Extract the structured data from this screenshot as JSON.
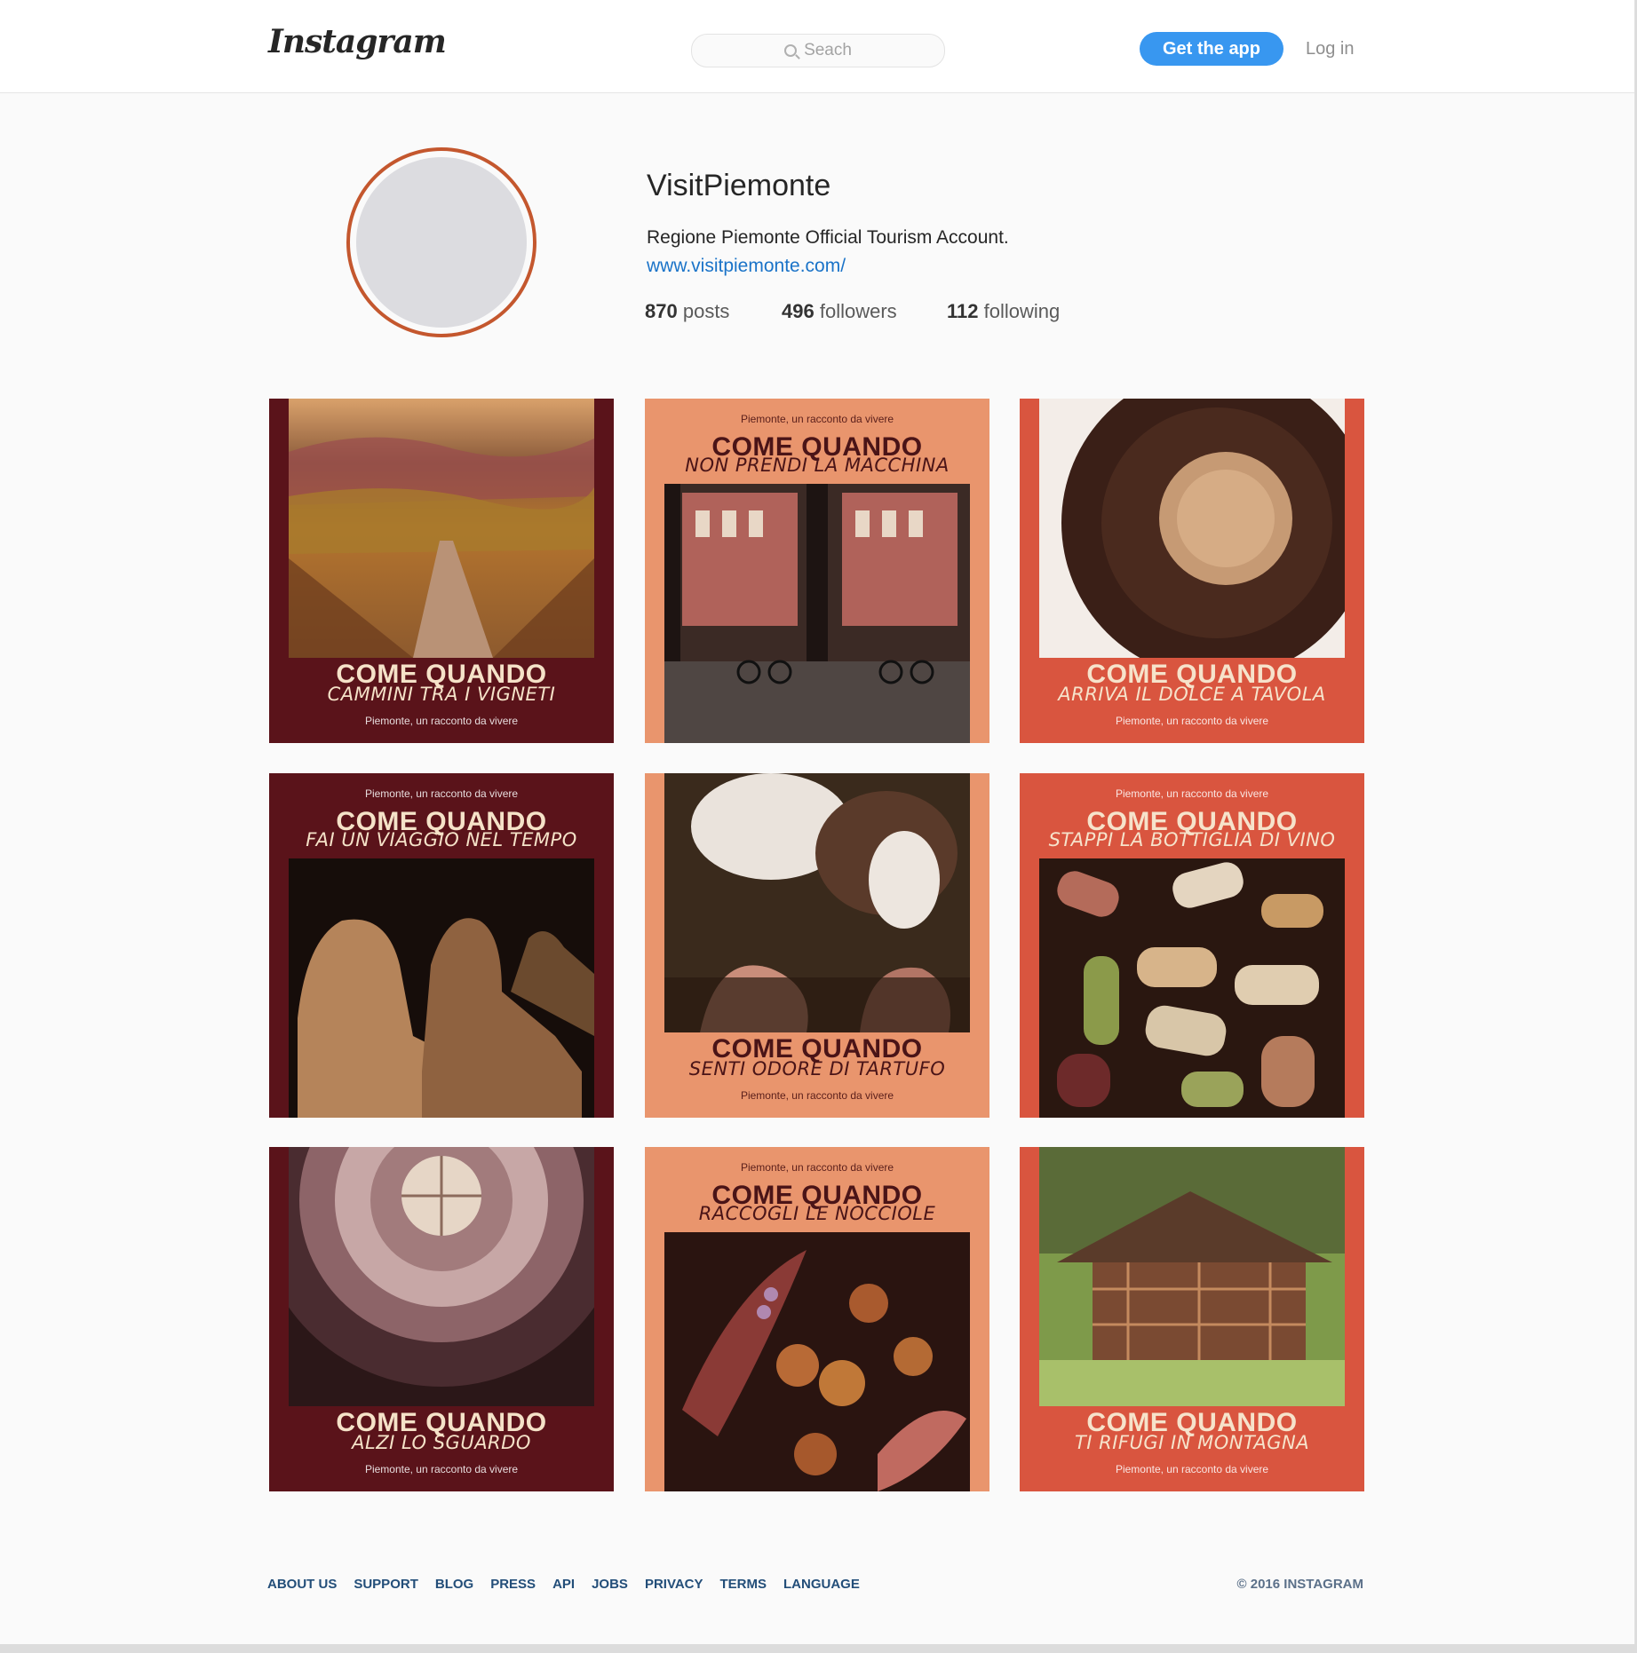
{
  "header": {
    "logo_text": "Instagram",
    "search_placeholder": "Seach",
    "get_app_label": "Get the app",
    "login_label": "Log in"
  },
  "profile": {
    "username": "VisitPiemonte",
    "bio": "Regione Piemonte Official Tourism Account.",
    "website": "www.visitpiemonte.com/",
    "stats": {
      "posts_count": "870",
      "posts_label": "posts",
      "followers_count": "496",
      "followers_label": "followers",
      "following_count": "112",
      "following_label": "following"
    }
  },
  "posts": [
    {
      "heading": "COME QUANDO",
      "subheading": "CAMMINI TRA I VIGNETI",
      "tagline": "Piemonte, un racconto da vivere",
      "theme": "dark",
      "scene": "vineyard hills"
    },
    {
      "heading": "COME QUANDO",
      "subheading": "NON PRENDI LA MACCHINA",
      "tagline": "Piemonte, un racconto da vivere",
      "theme": "salmon",
      "scene": "cyclists on city street"
    },
    {
      "heading": "COME QUANDO",
      "subheading": "ARRIVA IL DOLCE A TAVOLA",
      "tagline": "Piemonte, un racconto da vivere",
      "theme": "red",
      "scene": "chocolate cake"
    },
    {
      "heading": "COME QUANDO",
      "subheading": "FAI UN VIAGGIO NEL TEMPO",
      "tagline": "Piemonte, un racconto da vivere",
      "theme": "dark",
      "scene": "sphinx statues"
    },
    {
      "heading": "COME QUANDO",
      "subheading": "SENTI ODORE DI TARTUFO",
      "tagline": "Piemonte, un racconto da vivere",
      "theme": "salmon",
      "scene": "truffle dog"
    },
    {
      "heading": "COME QUANDO",
      "subheading": "STAPPI LA BOTTIGLIA DI VINO",
      "tagline": "Piemonte, un racconto da vivere",
      "theme": "red",
      "scene": "wine corks"
    },
    {
      "heading": "COME QUANDO",
      "subheading": "ALZI LO SGUARDO",
      "tagline": "Piemonte, un racconto da vivere",
      "theme": "dark",
      "scene": "dome interior"
    },
    {
      "heading": "COME QUANDO",
      "subheading": "RACCOGLI LE NOCCIOLE",
      "tagline": "Piemonte, un racconto da vivere",
      "theme": "salmon",
      "scene": "hazelnuts"
    },
    {
      "heading": "COME QUANDO",
      "subheading": "TI RIFUGI IN MONTAGNA",
      "tagline": "Piemonte, un racconto da vivere",
      "theme": "red",
      "scene": "mountain chalet"
    }
  ],
  "footer": {
    "links": [
      "ABOUT US",
      "SUPPORT",
      "BLOG",
      "PRESS",
      "API",
      "JOBS",
      "PRIVACY",
      "TERMS",
      "LANGUAGE"
    ],
    "copyright": "© 2016 INSTAGRAM"
  },
  "colors": {
    "accent_blue": "#3897f0",
    "avatar_ring": "#c4572e",
    "post_dark": "#5a131a",
    "post_salmon": "#e9956d",
    "post_red": "#d9553f"
  }
}
